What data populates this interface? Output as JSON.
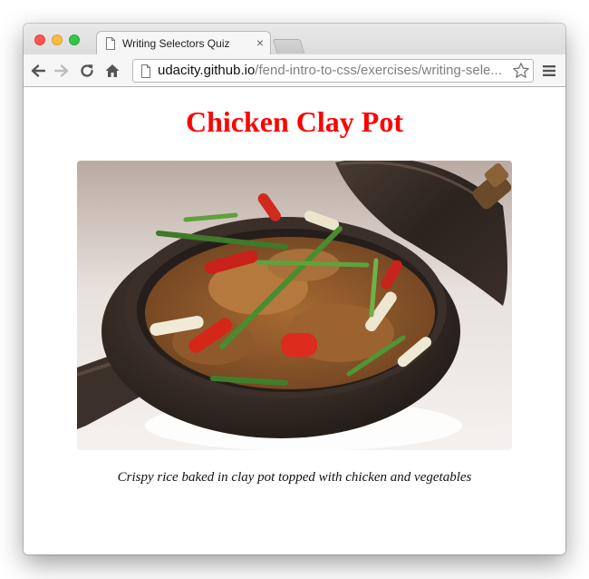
{
  "browser": {
    "tab": {
      "title": "Writing Selectors Quiz",
      "close_glyph": "×"
    },
    "address_bar": {
      "host": "udacity.github.io",
      "path": "/fend-intro-to-css/exercises/writing-sele..."
    },
    "icons": [
      "back-arrow-icon",
      "forward-arrow-icon",
      "reload-icon",
      "home-icon",
      "page-icon",
      "bookmark-star-icon",
      "menu-icon"
    ]
  },
  "page": {
    "heading": "Chicken Clay Pot",
    "caption": "Crispy rice baked in clay pot topped with chicken and vegetables"
  },
  "colors": {
    "heading": "#ff0000",
    "close": "#fc5753",
    "minimize": "#fdbc40",
    "maximize": "#33c748"
  }
}
